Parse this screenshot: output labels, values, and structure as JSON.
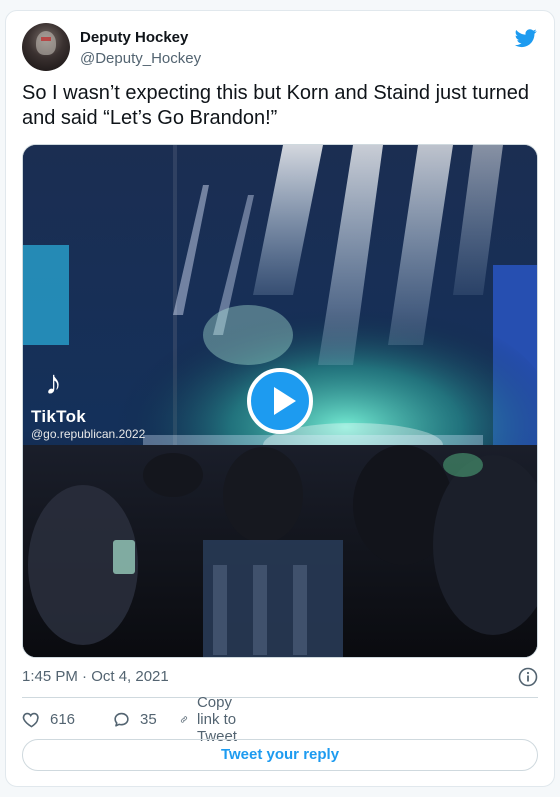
{
  "tweet": {
    "author_name": "Deputy Hockey",
    "author_handle": "@Deputy_Hockey",
    "text": "So I wasn’t expecting this but Korn and Staind just turned and said “Let’s Go Brandon!”",
    "timestamp": "1:45 PM · Oct 4, 2021"
  },
  "media": {
    "watermark_title": "TikTok",
    "watermark_user": "@go.republican.2022",
    "watermark_logo": "♪"
  },
  "actions": {
    "likes": "616",
    "replies": "35",
    "copy_link_label": "Copy link to Tweet"
  },
  "reply_button": {
    "label": "Tweet your reply"
  },
  "icons": {
    "brand": "twitter-bird-icon",
    "info": "info-icon",
    "like": "heart-icon",
    "reply": "speech-bubble-icon",
    "link": "link-icon",
    "play": "play-icon"
  },
  "colors": {
    "accent": "#1d9bf0",
    "text_primary": "#0f1419",
    "text_secondary": "#536471",
    "border": "#cfd9de"
  }
}
